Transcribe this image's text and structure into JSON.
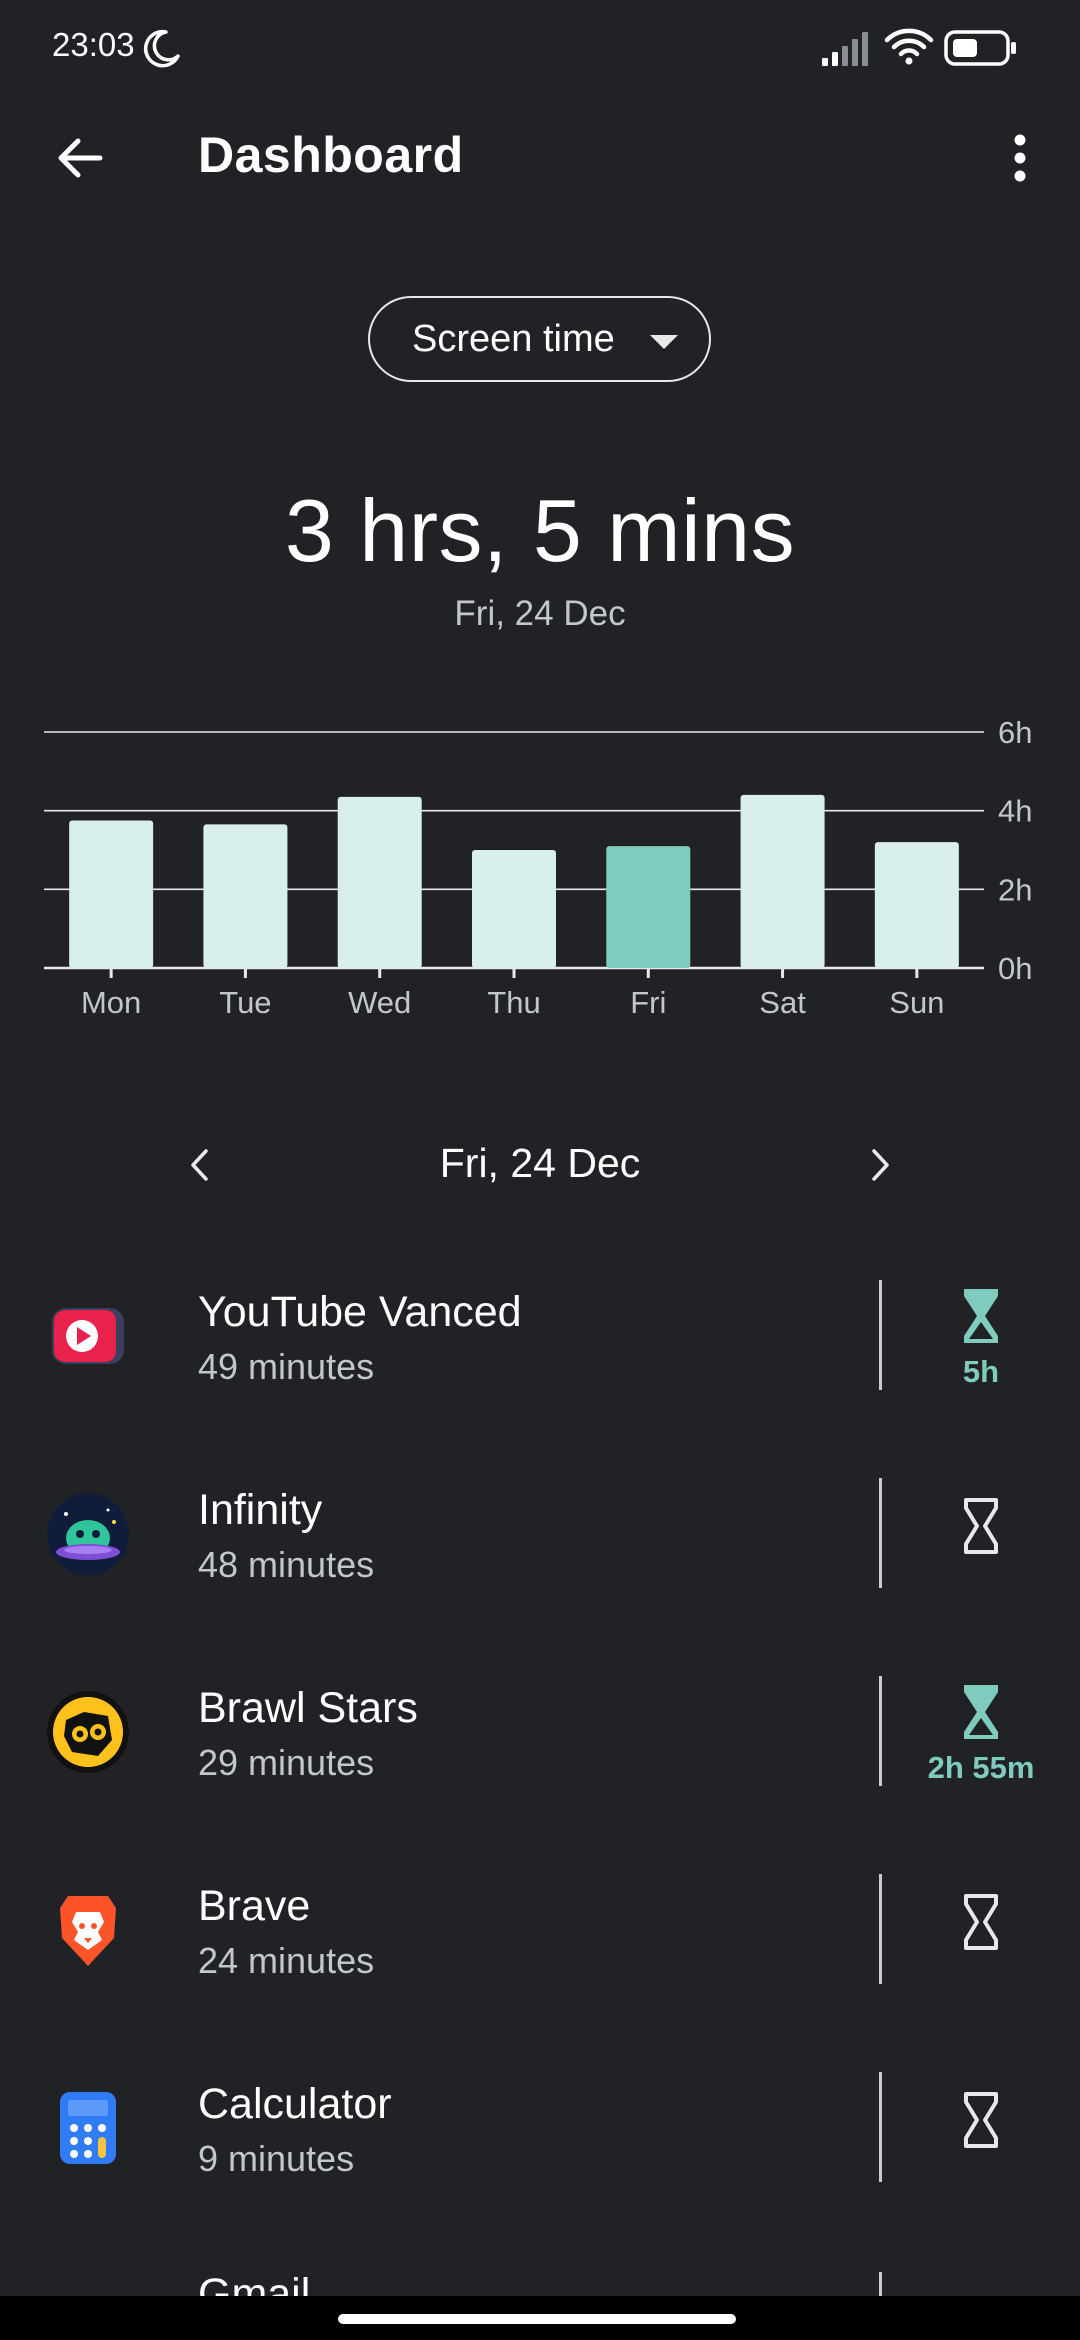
{
  "status_bar": {
    "time": "23:03",
    "icons": [
      "moon-icon",
      "signal-icon",
      "wifi-icon",
      "battery-icon"
    ]
  },
  "app_bar": {
    "title": "Dashboard",
    "back_icon": "arrow-left-icon",
    "menu_icon": "more-vert-icon"
  },
  "dropdown": {
    "selected": "Screen time"
  },
  "summary": {
    "total": "3 hrs, 5 mins",
    "date": "Fri, 24 Dec"
  },
  "chart_data": {
    "type": "bar",
    "categories": [
      "Mon",
      "Tue",
      "Wed",
      "Thu",
      "Fri",
      "Sat",
      "Sun"
    ],
    "values": [
      3.75,
      3.65,
      4.35,
      3.0,
      3.1,
      4.4,
      3.2
    ],
    "y_ticks": [
      "0h",
      "2h",
      "4h",
      "6h"
    ],
    "ylim": [
      0,
      6
    ],
    "highlighted_category": "Fri",
    "colors": {
      "bar": "#d9efec",
      "highlight": "#7fcbbd",
      "grid": "#e6e8ea"
    }
  },
  "day_nav": {
    "label": "Fri, 24 Dec",
    "prev_icon": "chevron-left-icon",
    "next_icon": "chevron-right-icon"
  },
  "apps": [
    {
      "name": "YouTube Vanced",
      "usage": "49 minutes",
      "icon": "youtube-vanced-icon",
      "timer_set": true,
      "limit": "5h"
    },
    {
      "name": "Infinity",
      "usage": "48 minutes",
      "icon": "infinity-icon",
      "timer_set": false,
      "limit": ""
    },
    {
      "name": "Brawl Stars",
      "usage": "29 minutes",
      "icon": "brawl-stars-icon",
      "timer_set": true,
      "limit": "2h 55m"
    },
    {
      "name": "Brave",
      "usage": "24 minutes",
      "icon": "brave-icon",
      "timer_set": false,
      "limit": ""
    },
    {
      "name": "Calculator",
      "usage": "9 minutes",
      "icon": "calculator-icon",
      "timer_set": false,
      "limit": ""
    }
  ],
  "partial_app": {
    "name": "Gmail"
  },
  "colors": {
    "background": "#202226",
    "accent": "#7fcbbd",
    "secondary_text": "#c3c6ca"
  }
}
